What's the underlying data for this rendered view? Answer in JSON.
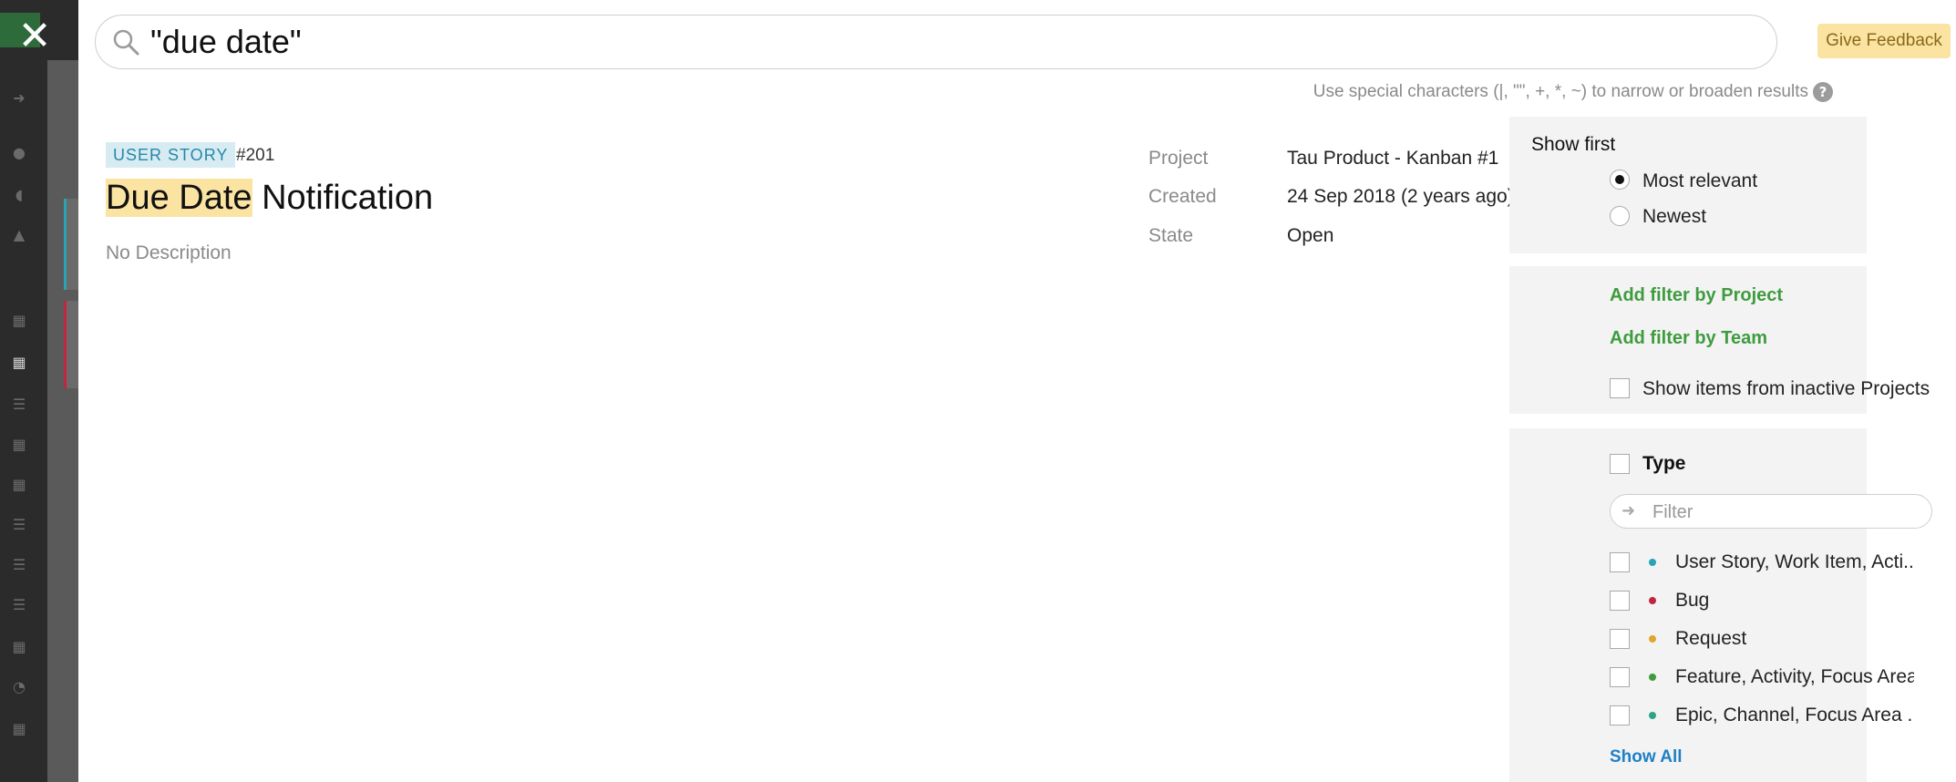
{
  "search": {
    "query": "\"due date\""
  },
  "header": {
    "feedback_label": "Give Feedback",
    "hint": "Use special characters (|, \"\", +, *, ~) to narrow or broaden results",
    "help_glyph": "?"
  },
  "result": {
    "type_badge": "USER STORY",
    "id": "#201",
    "title_highlight": "Due Date",
    "title_rest": " Notification",
    "description": "No Description",
    "meta": [
      {
        "label": "Project",
        "value": "Tau Product - Kanban #1"
      },
      {
        "label": "Created",
        "value": "24 Sep 2018 (2 years ago)"
      },
      {
        "label": "State",
        "value": "Open"
      }
    ]
  },
  "filters": {
    "show_first": {
      "title": "Show first",
      "options": [
        {
          "label": "Most relevant",
          "selected": true
        },
        {
          "label": "Newest",
          "selected": false
        }
      ]
    },
    "add_project": "Add filter by Project",
    "add_team": "Add filter by Team",
    "inactive_label": "Show items from inactive Projects",
    "type": {
      "title": "Type",
      "filter_placeholder": "Filter",
      "items": [
        {
          "label": "User Story, Work Item, Acti...",
          "color": "#2aa3b5"
        },
        {
          "label": "Bug",
          "color": "#c0263f"
        },
        {
          "label": "Request",
          "color": "#e0a62a"
        },
        {
          "label": "Feature, Activity, Focus Area",
          "color": "#3e9c3e"
        },
        {
          "label": "Epic, Channel, Focus Area ...",
          "color": "#2aa38a"
        }
      ],
      "show_all": "Show All"
    }
  },
  "icons": {
    "close": "close-icon",
    "search": "search-icon",
    "help": "help-icon",
    "filter_arrow": "arrow-right-icon"
  }
}
